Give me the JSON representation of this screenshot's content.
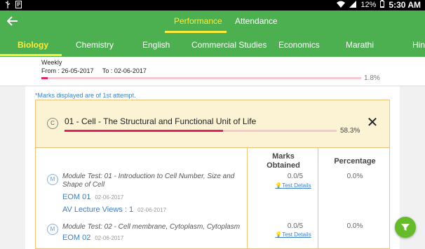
{
  "status": {
    "battery": "12%",
    "time": "5:30 AM"
  },
  "header": {
    "tabs": [
      {
        "label": "Performance"
      },
      {
        "label": "Attendance"
      }
    ],
    "subjects": [
      "Biology",
      "Chemistry",
      "English",
      "Commercial Studies",
      "Economics",
      "Marathi",
      "Hin"
    ]
  },
  "weekly": {
    "title": "Weekly",
    "from_label": "From : 26-05-2017",
    "to_label": "To : 02-06-2017",
    "percent_text": "1.8%",
    "progress": 0.018
  },
  "note": "*Marks displayed are of 1st attempt.",
  "topic": {
    "badge": "C",
    "title": "01 - Cell - The Structural and Functional Unit of Life",
    "percent_text": "58.3%",
    "progress": 0.583
  },
  "columns": {
    "marks": "Marks Obtained",
    "percentage": "Percentage"
  },
  "modules": [
    {
      "badge": "M",
      "title": "Module Test: 01 - Introduction to Cell Number, Size and Shape of Cell",
      "eom": "EOM 01",
      "eom_date": "02-06-2017",
      "av": "AV Lecture Views : 1",
      "av_date": "02-06-2017",
      "marks": "0.0/5",
      "test_details": "Test Details",
      "percentage": "0.0%"
    },
    {
      "badge": "M",
      "title": "Module Test: 02 - Cell membrane, Cytoplasm, Cytoplasm",
      "eom": "EOM 02",
      "eom_date": "02-06-2017",
      "marks": "0.0/5",
      "test_details": "Test Details",
      "percentage": "0.0%"
    }
  ],
  "colors": {
    "primary": "#4caf50",
    "accent": "#ffeb3b",
    "progress": "#e91e63",
    "fab": "#66bb2a"
  }
}
